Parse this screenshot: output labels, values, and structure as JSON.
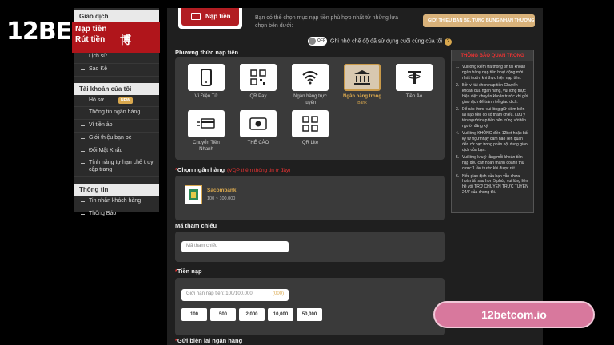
{
  "brand": {
    "logo_text": "12BE",
    "overlay": [
      "Nạp tiền",
      "Rút tiền",
      "博"
    ]
  },
  "sidebar": {
    "top_heading": "Giao dịch",
    "top_items": [
      "Lịch sử",
      "Sao Kê"
    ],
    "account_heading": "Tài khoản của tôi",
    "account_items": [
      {
        "label": "Hồ sơ",
        "badge": "NEW"
      },
      {
        "label": "Thông tin ngân hàng"
      },
      {
        "label": "Ví tiền ảo"
      },
      {
        "label": "Giới thiệu bạn bè"
      },
      {
        "label": "Đổi Mật Khẩu"
      },
      {
        "label": "Tính năng tự hạn chế truy cập trang"
      }
    ],
    "info_heading": "Thông tin",
    "info_items": [
      "Tin nhắn khách hàng",
      "Thông Báo"
    ]
  },
  "header": {
    "tab_label": "Nạp tiền",
    "description": "Bạn có thể chọn mục nạp tiền phù hợp nhất từ những lựa chọn bên dưới:",
    "promo_button": "GIỚI THIỆU BẠN BÈ, TUNG BỪNG NHẬN THƯỞNG"
  },
  "toggle": {
    "state": "OFF",
    "label": "Ghi nhớ chế độ đã sử dụng cuối cùng của tôi"
  },
  "methods": {
    "title": "Phương thức nạp tiền",
    "items": [
      {
        "label": "Ví Điện Tử",
        "icon": "phone-icon"
      },
      {
        "label": "QR Pay",
        "icon": "qr-icon"
      },
      {
        "label": "Ngân hàng trực tuyến",
        "icon": "wifi-icon"
      },
      {
        "label": "Ngân hàng trong",
        "sub": "Bank",
        "icon": "bank-icon",
        "active": true
      },
      {
        "label": "Tiền Ảo",
        "icon": "tether-icon"
      },
      {
        "label": "Chuyển Tiền Nhanh",
        "icon": "fast-transfer-icon"
      },
      {
        "label": "THẺ CÀO",
        "icon": "card-icon"
      },
      {
        "label": "QR Lite",
        "icon": "qr-lite-icon"
      }
    ]
  },
  "bank_select": {
    "title": "Chọn ngân hàng",
    "note": "(VQP thêm thông tin ở đây)",
    "bank_name": "Sacombank",
    "range": "100 ~ 100,000"
  },
  "reference": {
    "title": "Mã tham chiếu",
    "placeholder": "Mã tham chiếu"
  },
  "deposit": {
    "title": "Tiền nạp",
    "placeholder": "Giới hạn nạp tiền: 100/100,000",
    "unit": "(000)",
    "amounts": [
      "100",
      "500",
      "2,000",
      "10,000",
      "50,000"
    ]
  },
  "receipt": {
    "title": "Gửi biên lai ngân hàng"
  },
  "notice": {
    "title": "THÔNG BÁO QUAN TRỌNG",
    "items": [
      "Vui lòng kiểm tra thông tin tài khoản ngân hàng nạp tiền hoạt động mới nhất trước khi thực hiện nạp tiền.",
      "Bởi vì tài chọn nạp tiền Chuyển khoản qua ngân hàng, vui lòng thực hiện việc chuyển khoản trước khi gửi giao dịch để tránh trễ giao dịch.",
      "Để xác thực, vui lòng giữ kiểm biên lai nạp tiền có số tham chiếu. Lưu ý tên người nạp tiền nên trùng với tên người đăng ký",
      "Vui lòng KHÔNG điền 12bet hoặc bất kỳ từ ngữ nhạy cảm nào liên quan đến cờ bạc trong phần nội dung giao dịch của bạn.",
      "Vui lòng lưu ý rằng mỗi khoản tiền nạp đều cần hoàn thành doanh thu cược 1 lần trước khi được rút.",
      "Nếu giao dịch của bạn vẫn chưa hoàn tất sau hơn 5 phút, vui lòng liên hệ với TRỢ CHUYỆN TRỰC TUYẾN 24/7 của chúng tôi."
    ]
  },
  "watermark": {
    "label": "12betcom.io"
  }
}
